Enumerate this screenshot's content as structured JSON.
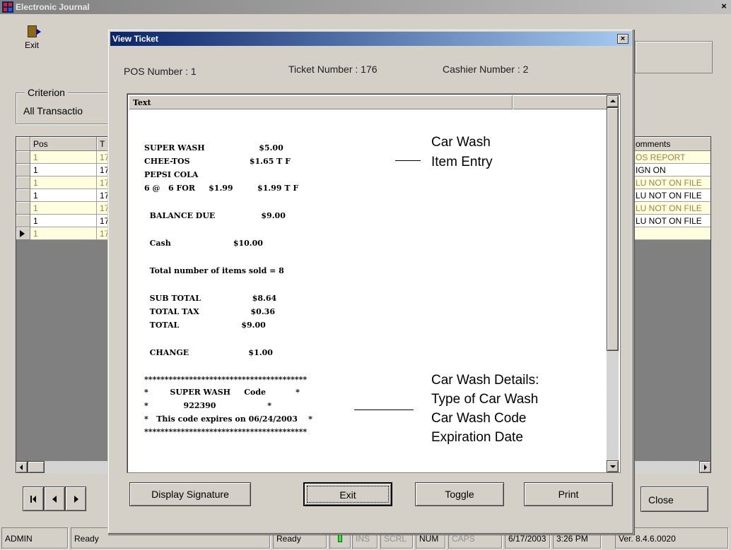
{
  "window": {
    "title": "Electronic Journal",
    "close": "×"
  },
  "toolbar": {
    "exit_label": "Exit"
  },
  "criterion": {
    "legend": "Criterion",
    "value": "All Transactio"
  },
  "grid": {
    "headers": [
      "Pos",
      "T",
      "omments"
    ],
    "rows": [
      {
        "pos": "1",
        "t": "17",
        "comment": "OS REPORT",
        "alt": true
      },
      {
        "pos": "1",
        "t": "17",
        "comment": "IGN ON",
        "alt": false
      },
      {
        "pos": "1",
        "t": "17",
        "comment": "LU NOT ON FILE",
        "alt": true
      },
      {
        "pos": "1",
        "t": "17",
        "comment": "LU NOT ON FILE",
        "alt": false
      },
      {
        "pos": "1",
        "t": "17",
        "comment": "LU NOT ON FILE",
        "alt": true
      },
      {
        "pos": "1",
        "t": "17",
        "comment": "LU NOT ON FILE",
        "alt": false
      },
      {
        "pos": "1",
        "t": "17",
        "comment": "",
        "alt": true
      }
    ]
  },
  "close_button": "Close",
  "status": {
    "user": "ADMIN",
    "msg": "Ready",
    "msg2": "Ready",
    "ins": "INS",
    "scrl": "SCRL",
    "num": "NUM",
    "caps": "CAPS",
    "date": "6/17/2003",
    "time": "3:26 PM",
    "version": "Ver. 8.4.6.0020"
  },
  "dialog": {
    "title": "View Ticket",
    "close": "×",
    "pos_number": "POS Number : 1",
    "ticket_number": "Ticket Number : 176",
    "cashier_number": "Cashier Number : 2",
    "column_header": "Text",
    "receipt": [
      "SUPER WASH                    $5.00",
      "CHEE-TOS                      $1.65 T F",
      "PEPSI COLA",
      "6 @   6 FOR     $1.99         $1.99 T F",
      "  BALANCE DUE                 $9.00",
      "  Cash                       $10.00",
      "  Total number of items sold = 8",
      "  SUB TOTAL                   $8.64",
      "  TOTAL TAX                   $0.36",
      "  TOTAL                       $9.00",
      "  CHANGE                      $1.00",
      "****************************************",
      "*        SUPER WASH     Code           *",
      "*             922390                   *",
      "*   This code expires on 06/24/2003    *",
      "****************************************"
    ],
    "annotations": {
      "item_line1": "Car Wash",
      "item_line2": "Item Entry",
      "details_line1": "Car Wash Details:",
      "details_line2": "Type of Car Wash",
      "details_line3": "Car Wash Code",
      "details_line4": "Expiration Date"
    },
    "buttons": {
      "display_signature": "Display Signature",
      "exit": "Exit",
      "toggle": "Toggle",
      "print": "Print"
    }
  }
}
